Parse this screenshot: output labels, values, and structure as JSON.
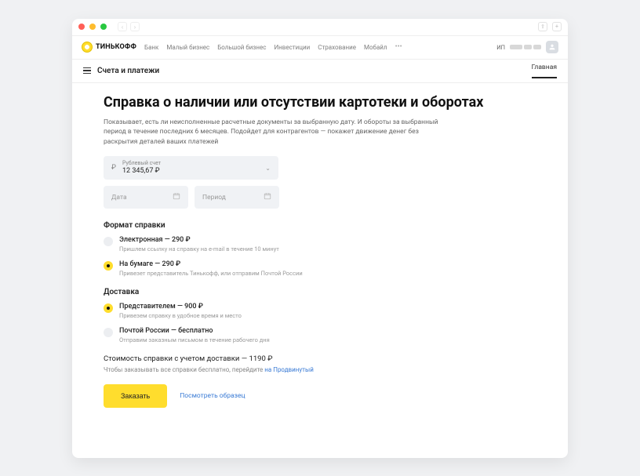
{
  "brand": "ТИНЬКОФФ",
  "nav": {
    "items": [
      "Банк",
      "Малый бизнес",
      "Большой бизнес",
      "Инвестиции",
      "Страхование",
      "Мобайл"
    ]
  },
  "account": {
    "prefix": "ИП"
  },
  "subnav": {
    "title": "Счета и платежи",
    "tab": "Главная"
  },
  "page": {
    "title": "Справка о наличии или отсутствии картотеки и оборотах",
    "lead": "Показывает, есть ли неисполненные расчетные документы за выбранную дату. И обороты за выбранный период в течение последних 6 месяцев. Подойдет для контрагентов — покажет движение денег без раскрытия деталей ваших платежей"
  },
  "accountSelect": {
    "label": "Рублевый счет",
    "value": "12 345,67 ₽"
  },
  "fields": {
    "date": "Дата",
    "period": "Период"
  },
  "format": {
    "title": "Формат справки",
    "options": [
      {
        "label": "Электронная — 290 ₽",
        "sub": "Пришлем ссылку на справку на e-mail в течение 10 минут",
        "selected": false
      },
      {
        "label": "На бумаге — 290 ₽",
        "sub": "Привезет представитель Тинькофф, или отправим Почтой России",
        "selected": true
      }
    ]
  },
  "delivery": {
    "title": "Доставка",
    "options": [
      {
        "label": "Представителем — 900 ₽",
        "sub": "Привезем справку в удобное время и место",
        "selected": true
      },
      {
        "label": "Почтой России — бесплатно",
        "sub": "Отправим заказным письмом в течение рабочего дня",
        "selected": false
      }
    ]
  },
  "total": {
    "line": "Стоимость справки с учетом доставки — 1190 ₽",
    "sub_prefix": "Чтобы заказывать все справки бесплатно, перейдите ",
    "sub_link": "на Продвинутый"
  },
  "actions": {
    "order": "Заказать",
    "sample": "Посмотреть образец"
  }
}
